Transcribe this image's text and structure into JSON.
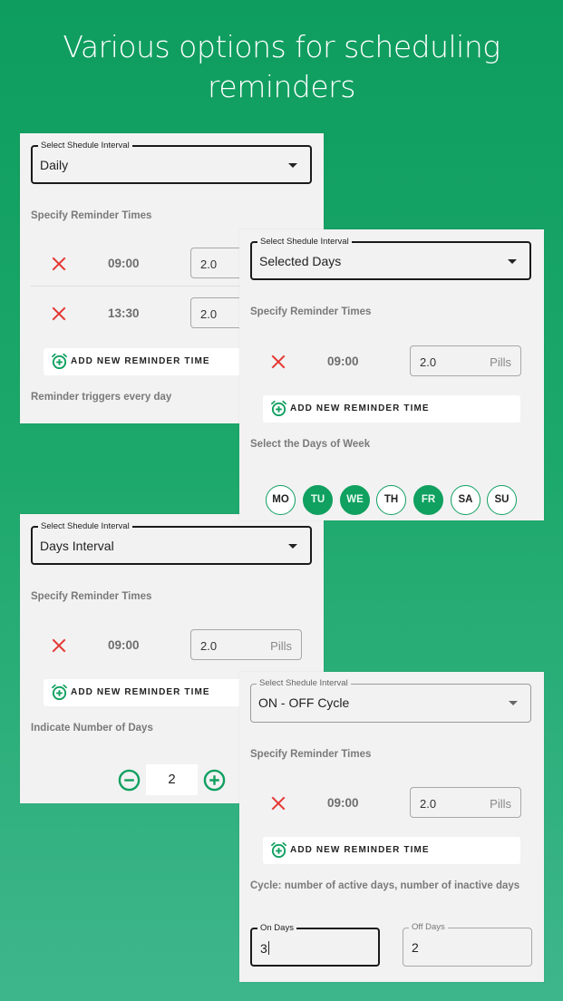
{
  "headline": {
    "line1": "Various options for scheduling",
    "line2": "reminders"
  },
  "colors": {
    "accent": "#10a060",
    "delete": "#e53935",
    "background_top": "#0e9d5f",
    "background_bottom": "#3eb68c"
  },
  "common": {
    "select_label": "Select Shedule Interval",
    "reminder_times_label": "Specify Reminder Times",
    "add_button_label": "ADD NEW REMINDER TIME",
    "unit": "Pills",
    "delete_icon": "close-icon",
    "add_icon": "alarm-add-icon"
  },
  "panels": [
    {
      "schedule_interval": "Daily",
      "reminders": [
        {
          "time": "09:00",
          "quantity": "2.0"
        },
        {
          "time": "13:30",
          "quantity": "2.0"
        }
      ],
      "note": "Reminder triggers every day"
    },
    {
      "schedule_interval": "Selected Days",
      "reminders": [
        {
          "time": "09:00",
          "quantity": "2.0"
        }
      ],
      "days_label": "Select the Days of Week",
      "days": [
        {
          "label": "MO",
          "selected": false
        },
        {
          "label": "TU",
          "selected": true
        },
        {
          "label": "WE",
          "selected": true
        },
        {
          "label": "TH",
          "selected": false
        },
        {
          "label": "FR",
          "selected": true
        },
        {
          "label": "SA",
          "selected": false
        },
        {
          "label": "SU",
          "selected": false
        }
      ]
    },
    {
      "schedule_interval": "Days Interval",
      "reminders": [
        {
          "time": "09:00",
          "quantity": "2.0"
        }
      ],
      "days_label": "Indicate Number of Days",
      "number_of_days": "2"
    },
    {
      "schedule_interval": "ON - OFF Cycle",
      "reminders": [
        {
          "time": "09:00",
          "quantity": "2.0"
        }
      ],
      "cycle_label": "Cycle: number of active days, number of inactive days",
      "on_days_label": "On Days",
      "on_days": "3",
      "off_days_label": "Off Days",
      "off_days": "2"
    }
  ]
}
